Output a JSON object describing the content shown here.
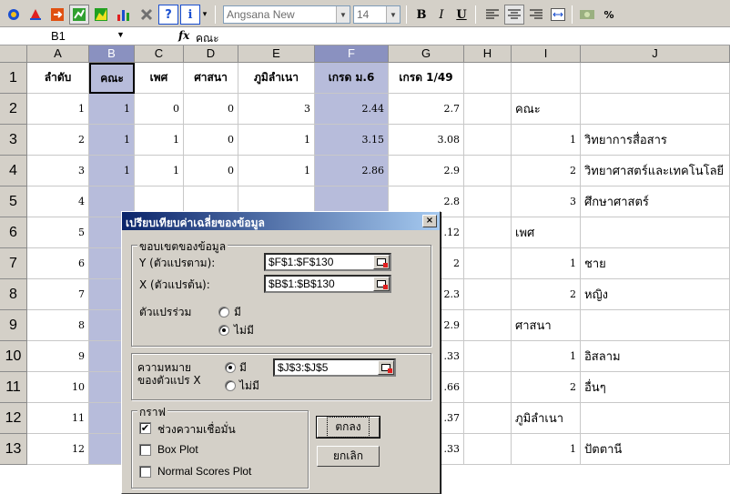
{
  "toolbar": {
    "font_name": "Angsana New",
    "font_size": "14",
    "bold_label": "B",
    "italic_label": "I",
    "underline_label": "U",
    "percent_label": "%"
  },
  "formula_bar": {
    "name_box": "B1",
    "fx_label": "fx",
    "value": "คณะ"
  },
  "columns": [
    "A",
    "B",
    "C",
    "D",
    "E",
    "F",
    "G",
    "H",
    "I",
    "J"
  ],
  "rows": [
    "1",
    "2",
    "3",
    "4",
    "5",
    "6",
    "7",
    "8",
    "9",
    "10",
    "11",
    "12",
    "13"
  ],
  "header_cells": {
    "A": "ลำดับ",
    "B": "คณะ",
    "C": "เพศ",
    "D": "ศาสนา",
    "E": "ภูมิลำเนา",
    "F": "เกรด ม.6",
    "G": "เกรด 1/49"
  },
  "data_rows": [
    {
      "A": "1",
      "B": "1",
      "C": "0",
      "D": "0",
      "E": "3",
      "F": "2.44",
      "G": "2.7"
    },
    {
      "A": "2",
      "B": "1",
      "C": "1",
      "D": "0",
      "E": "1",
      "F": "3.15",
      "G": "3.08"
    },
    {
      "A": "3",
      "B": "1",
      "C": "1",
      "D": "0",
      "E": "1",
      "F": "2.86",
      "G": "2.9"
    },
    {
      "A": "4",
      "G": "2.8"
    },
    {
      "A": "5",
      "G": ".12"
    },
    {
      "A": "6",
      "G": "2"
    },
    {
      "A": "7",
      "G": "2.3"
    },
    {
      "A": "8",
      "G": "2.9"
    },
    {
      "A": "9",
      "G": ".33"
    },
    {
      "A": "10",
      "G": ".66"
    },
    {
      "A": "11",
      "G": ".37"
    },
    {
      "A": "12",
      "G": ".33"
    }
  ],
  "legend_cells": {
    "I2": "คณะ",
    "I3": "1",
    "J3": "วิทยาการสื่อสาร",
    "I4": "2",
    "J4": "วิทยาศาสตร์และเทคโนโลยี",
    "I5": "3",
    "J5": "ศึกษาศาสตร์",
    "I6": "เพศ",
    "I7": "1",
    "J7": "ชาย",
    "I8": "2",
    "J8": "หญิง",
    "I9": "ศาสนา",
    "I10": "1",
    "J10": "อิสลาม",
    "I11": "2",
    "J11": "อื่นๆ",
    "I12": "ภูมิลำเนา",
    "I13": "1",
    "J13": "ปัตตานี"
  },
  "dialog": {
    "title": "เปรียบเทียบค่าเฉลี่ยของข้อมูล",
    "close_label": "×",
    "range_group": "ขอบเขตของข้อมูล",
    "y_label": "Y (ตัวแปรตาม):",
    "y_value": "$F$1:$F$130",
    "x_label": "X (ตัวแปรต้น):",
    "x_value": "$B$1:$B$130",
    "covariate_label": "ตัวแปรร่วม",
    "covariate_yes": "มี",
    "covariate_no": "ไม่มี",
    "covariate_selected": "no",
    "meaning_label_1": "ความหมาย",
    "meaning_label_2": "ของตัวแปร X",
    "meaning_yes": "มี",
    "meaning_no": "ไม่มี",
    "meaning_selected": "yes",
    "meaning_value": "$J$3:$J$5",
    "graph_group": "กราฟ",
    "ci_label": "ช่วงความเชื่อมั่น",
    "ci_checked": true,
    "boxplot_label": "Box Plot",
    "boxplot_checked": false,
    "normal_label": "Normal Scores Plot",
    "normal_checked": false,
    "ok_label": "ตกลง",
    "cancel_label": "ยกเลิก"
  }
}
